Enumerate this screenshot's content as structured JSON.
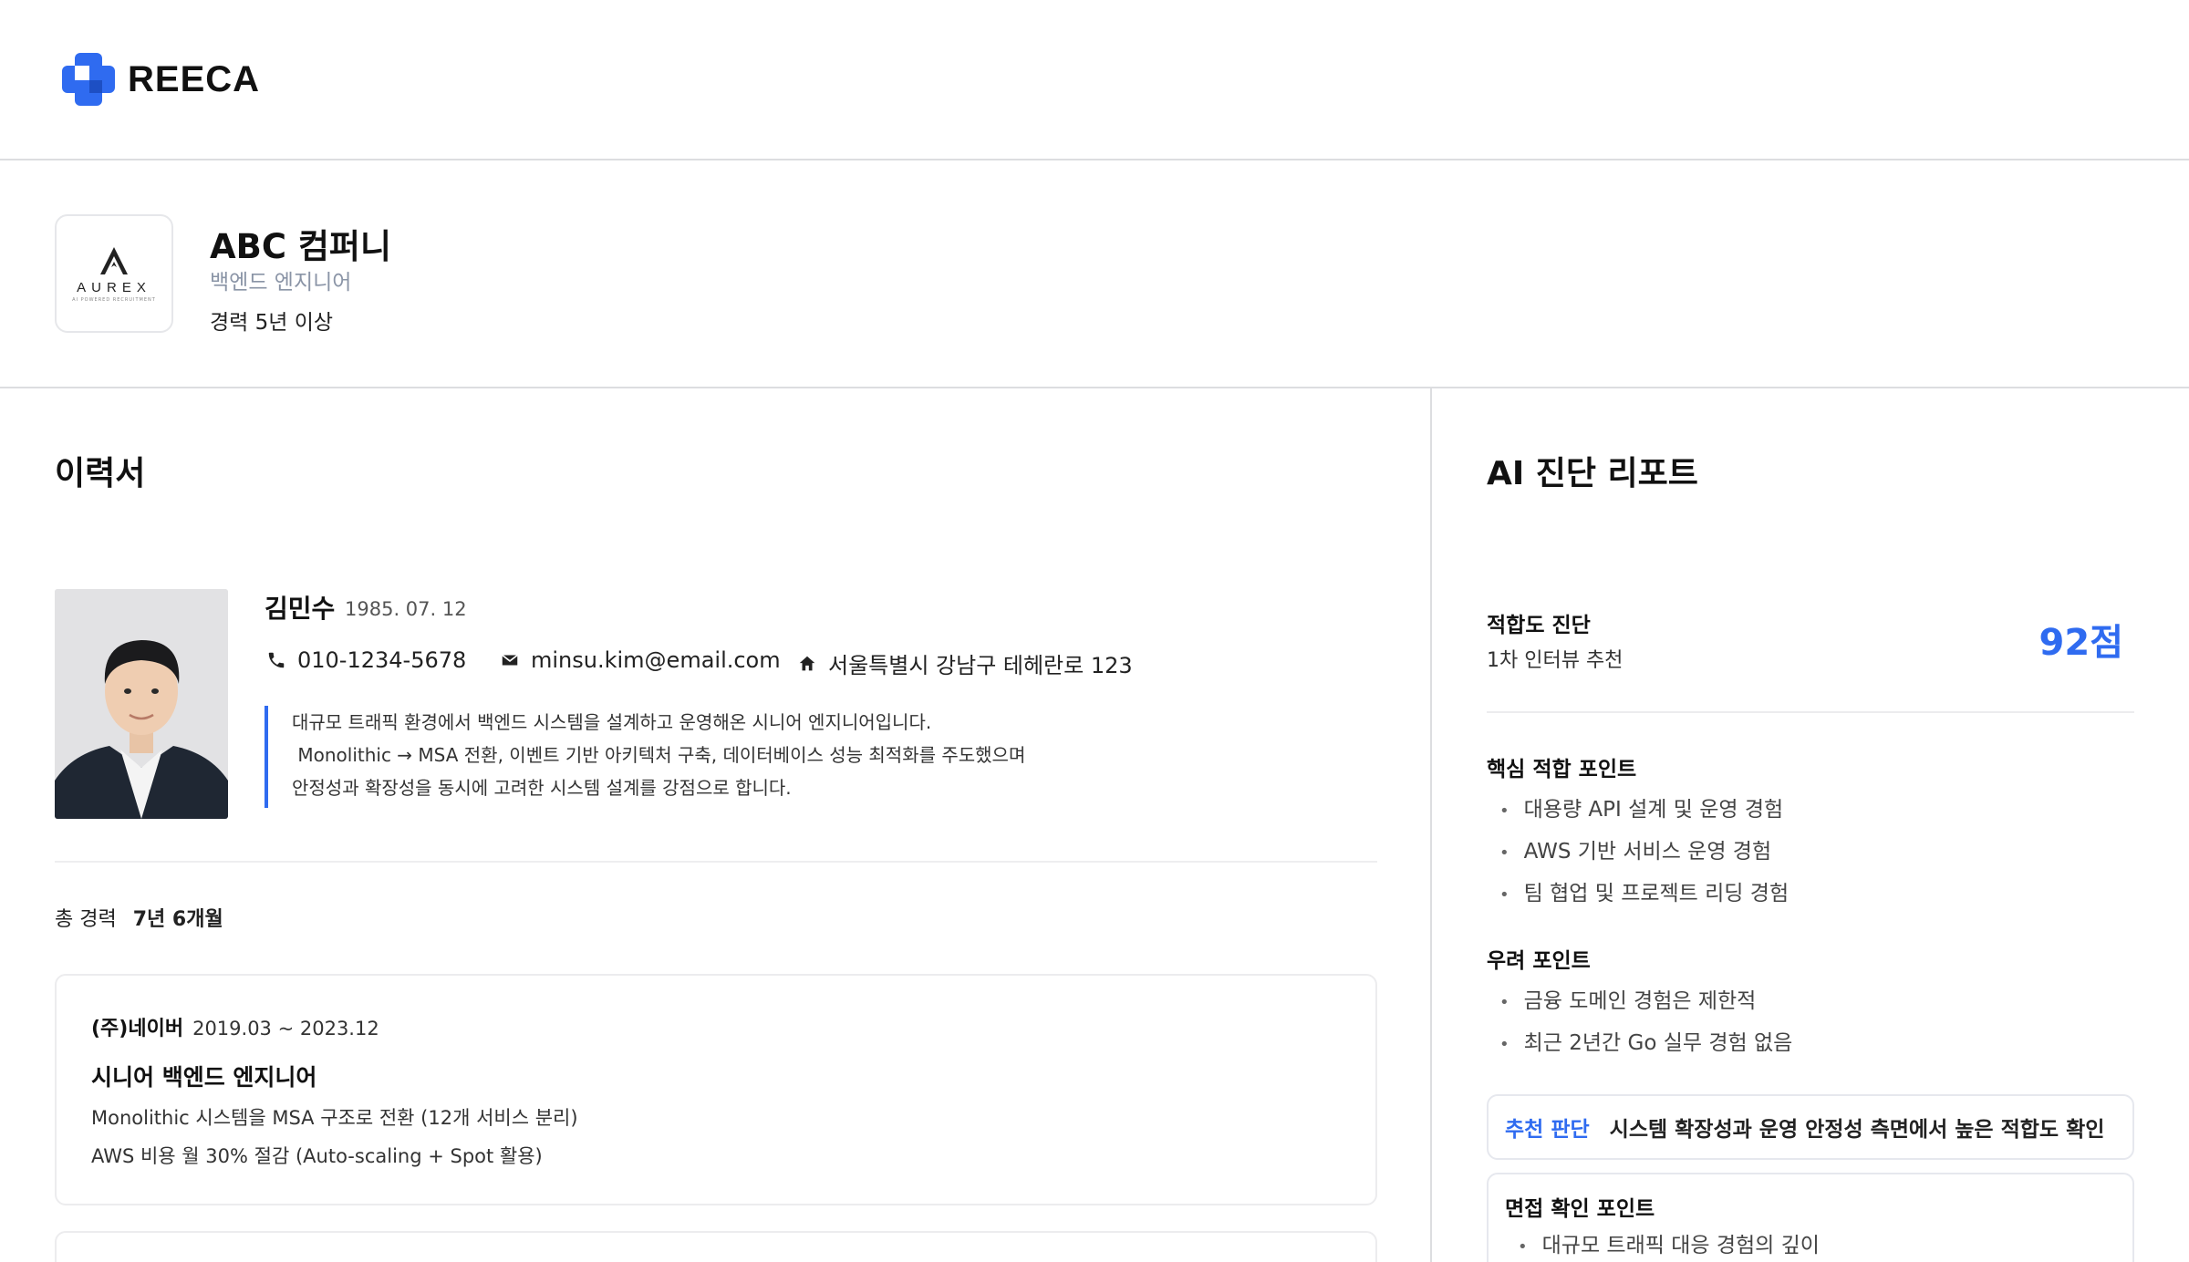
{
  "brand": {
    "name": "REECA",
    "color": "#2f6bf0"
  },
  "company": {
    "logo_text": "AUREX",
    "logo_sub": "AI POWERED RECRUITMENT",
    "name": "ABC 컴퍼니",
    "role": "백엔드 엔지니어",
    "experience": "경력 5년 이상"
  },
  "resume": {
    "title": "이력서",
    "name": "김민수",
    "birth": "1985. 07. 12",
    "phone": "010-1234-5678",
    "email": "minsu.kim@email.com",
    "address": "서울특별시 강남구 테헤란로 123",
    "summary": [
      "대규모 트래픽 환경에서 백엔드 시스템을 설계하고 운영해온 시니어 엔지니어입니다.",
      " Monolithic → MSA 전환, 이벤트 기반 아키텍처 구축, 데이터베이스 성능 최적화를 주도했으며",
      "안정성과 확장성을 동시에 고려한 시스템 설계를 강점으로 합니다."
    ],
    "total_label": "총 경력",
    "total_value": "7년 6개월",
    "careers": [
      {
        "company": "(주)네이버",
        "period": "2019.03 ~ 2023.12",
        "role": "시니어 백엔드 엔지니어",
        "lines": [
          "Monolithic 시스템을 MSA 구조로 전환 (12개 서비스 분리)",
          "AWS 비용 월 30% 절감 (Auto-scaling + Spot 활용)"
        ]
      }
    ]
  },
  "report": {
    "title": "AI 진단 리포트",
    "fit_label": "적합도 진단",
    "fit_sub": "1차 인터뷰 추천",
    "score": "92점",
    "core_title": "핵심 적합 포인트",
    "core_points": [
      "대용량 API 설계 및 운영 경험",
      "AWS 기반 서비스 운영 경험",
      "팀 협업 및 프로젝트 리딩 경험"
    ],
    "concern_title": "우려 포인트",
    "concern_points": [
      "금융 도메인 경험은 제한적",
      "최근 2년간 Go 실무 경험 없음"
    ],
    "reco_tag": "추천 판단",
    "reco_text": "시스템 확장성과 운영 안정성 측면에서 높은 적합도 확인",
    "interview_title": "면접 확인 포인트",
    "interview_points": [
      "대규모 트래픽 대응 경험의 깊이"
    ]
  }
}
